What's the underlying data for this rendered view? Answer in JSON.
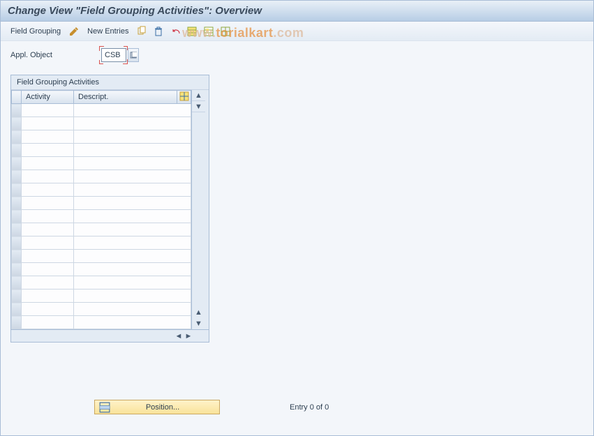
{
  "title": "Change View \"Field Grouping Activities\": Overview",
  "toolbar": {
    "field_grouping": "Field Grouping",
    "new_entries": "New Entries"
  },
  "appl_object": {
    "label": "Appl. Object",
    "value": "CSB"
  },
  "panel": {
    "title": "Field Grouping Activities",
    "columns": {
      "activity": "Activity",
      "descript": "Descript."
    }
  },
  "position_btn": "Position...",
  "entry_text": "Entry 0 of 0",
  "watermark_a": "www.",
  "watermark_b": "torialkart",
  "watermark_c": ".com",
  "row_count": 17
}
